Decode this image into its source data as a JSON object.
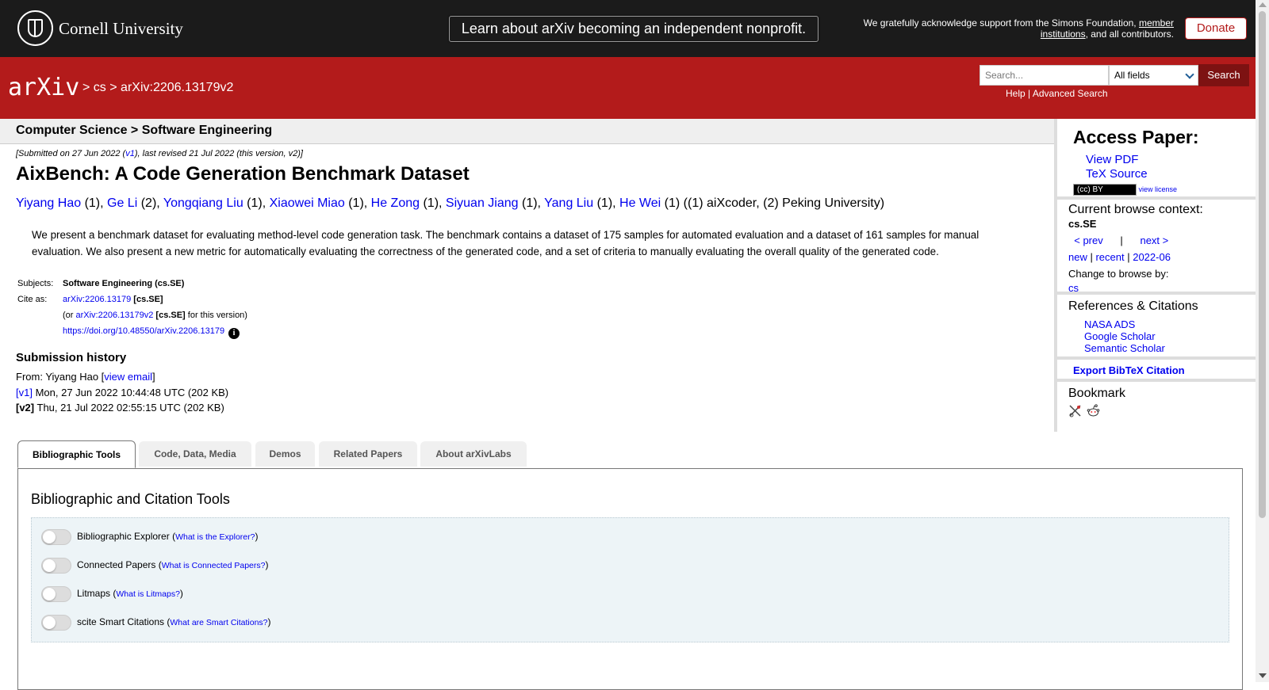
{
  "topbar": {
    "university": "Cornell University",
    "announcement": "Learn about arXiv becoming an independent nonprofit.",
    "ack_text": "We gratefully acknowledge support from the Simons Foundation,",
    "ack_link": "member institutions",
    "ack_tail": ", and all contributors.",
    "donate": "Donate"
  },
  "header": {
    "logo_text": "arXiv",
    "crumb_sep1": ">",
    "crumb_cs": "cs",
    "crumb_sep2": ">",
    "crumb_id": "arXiv:2206.13179v2",
    "search_placeholder": "Search...",
    "search_field": "All fields",
    "search_button": "Search",
    "help": "Help",
    "help_sep": " | ",
    "advanced": "Advanced Search"
  },
  "paper": {
    "subject_header": "Computer Science > Software Engineering",
    "date_pre": "[Submitted on 27 Jun 2022 (",
    "date_v1": "v1",
    "date_post": "), last revised 21 Jul 2022 (this version, v2)]",
    "title": "AixBench: A Code Generation Benchmark Dataset",
    "authors": [
      {
        "name": "Yiyang Hao",
        "aff": " (1), "
      },
      {
        "name": "Ge Li",
        "aff": " (2), "
      },
      {
        "name": "Yongqiang Liu",
        "aff": " (1), "
      },
      {
        "name": "Xiaowei Miao",
        "aff": " (1), "
      },
      {
        "name": "He Zong",
        "aff": " (1), "
      },
      {
        "name": "Siyuan Jiang",
        "aff": " (1), "
      },
      {
        "name": "Yang Liu",
        "aff": " (1), "
      },
      {
        "name": "He Wei",
        "aff": " (1) "
      }
    ],
    "affiliations": "((1) aiXcoder, (2) Peking University)",
    "abstract": "We present a benchmark dataset for evaluating method-level code generation task. The benchmark contains a dataset of 175 samples for automated evaluation and a dataset of 161 samples for manual evaluation. We also present a new metric for automatically evaluating the correctness of the generated code, and a set of criteria to manually evaluating the overall quality of the generated code.",
    "subjects_label": "Subjects:",
    "subjects_value": "Software Engineering (cs.SE)",
    "cite_label": "Cite as:",
    "cite_id": "arXiv:2206.13179",
    "cite_cat": "[cs.SE]",
    "cite_or": "(or ",
    "cite_v2": "arXiv:2206.13179v2",
    "cite_v2_cat": "[cs.SE]",
    "cite_v2_tail": " for this version)",
    "doi": "https://doi.org/10.48550/arXiv.2206.13179",
    "info_glyph": "i"
  },
  "history": {
    "title": "Submission history",
    "from_pre": "From: Yiyang Hao [",
    "view_email": "view email",
    "from_post": "]",
    "v1_tag": "[v1]",
    "v1_text": " Mon, 27 Jun 2022 10:44:48 UTC (202 KB)",
    "v2_tag": "[v2]",
    "v2_text": " Thu, 21 Jul 2022 02:55:15 UTC (202 KB)"
  },
  "sidebar": {
    "access_title": "Access Paper:",
    "view_pdf": "View PDF",
    "tex_source": "TeX Source",
    "cc_badge": "(cc) BY",
    "view_license": "view license",
    "context_title": "Current browse context:",
    "context_value": "cs.SE",
    "prev": "< prev",
    "nav_sep": "|",
    "next": "next >",
    "new": "new",
    "recent": "recent",
    "month": "2022-06",
    "sep": " | ",
    "change_browse": "Change to browse by:",
    "browse_cs": "cs",
    "refs_title": "References & Citations",
    "refs": [
      "NASA ADS",
      "Google Scholar",
      "Semantic Scholar"
    ],
    "bibtex": "Export BibTeX Citation",
    "bookmark_title": "Bookmark"
  },
  "tabs": [
    "Bibliographic Tools",
    "Code, Data, Media",
    "Demos",
    "Related Papers",
    "About arXivLabs"
  ],
  "panel": {
    "title": "Bibliographic and Citation Tools",
    "tools": [
      {
        "label": "Bibliographic Explorer",
        "open": " (",
        "link": "What is the Explorer?",
        "close": ")"
      },
      {
        "label": "Connected Papers",
        "open": " (",
        "link": "What is Connected Papers?",
        "close": ")"
      },
      {
        "label": "Litmaps",
        "open": " (",
        "link": "What is Litmaps?",
        "close": ")"
      },
      {
        "label": "scite Smart Citations",
        "open": " (",
        "link": "What are Smart Citations?",
        "close": ")"
      }
    ]
  },
  "colors": {
    "arxiv_red": "#b31b1b",
    "top_black": "#1b1b1b",
    "link_blue": "#0000ee"
  }
}
